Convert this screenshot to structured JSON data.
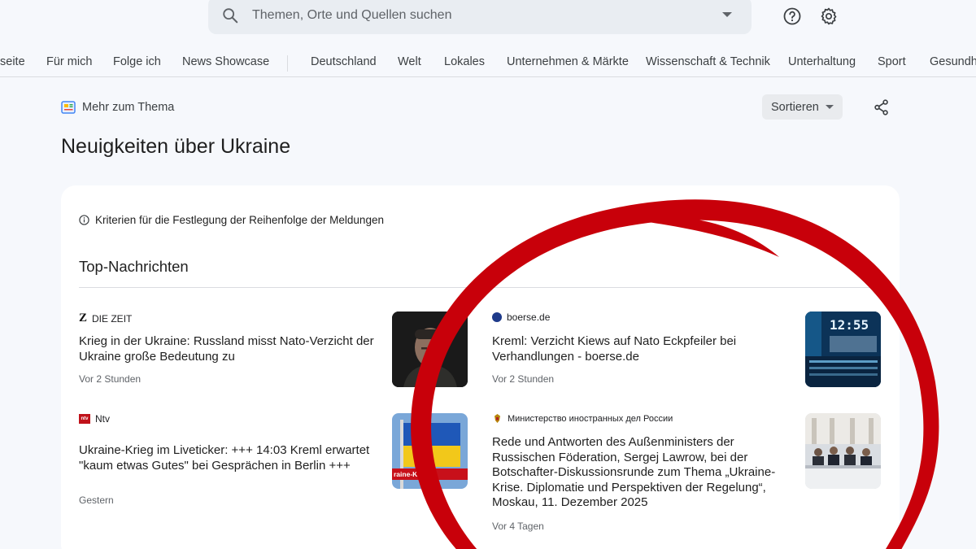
{
  "search": {
    "placeholder": "Themen, Orte und Quellen suchen"
  },
  "nav": {
    "items": [
      "seite",
      "Für mich",
      "Folge ich",
      "News Showcase",
      "Deutschland",
      "Welt",
      "Lokales",
      "Unternehmen & Märkte",
      "Wissenschaft & Technik",
      "Unterhaltung",
      "Sport",
      "Gesundhe"
    ]
  },
  "section": {
    "label": "Mehr zum Thema",
    "sort_label": "Sortieren",
    "title": "Neuigkeiten über Ukraine"
  },
  "card": {
    "criteria": "Kriterien für die Festlegung der Reihenfolge der Meldungen",
    "top_title": "Top-Nachrichten",
    "articles": [
      {
        "source": "DIE ZEIT",
        "logo": "Z",
        "headline": "Krieg in der Ukraine: Russland misst Nato-Verzicht der Ukraine große Bedeutung zu",
        "time": "Vor 2 Stunden"
      },
      {
        "source": "boerse.de",
        "headline": "Kreml: Verzicht Kiews auf Nato Eckpfeiler bei Verhandlungen - boerse.de",
        "time": "Vor 2 Stunden"
      },
      {
        "source": "Ntv",
        "logo": "ntv",
        "headline": "Ukraine-Krieg im Liveticker: +++ 14:03 Kreml erwartet \"kaum etwas Gutes\" bei Gesprächen in Berlin +++",
        "time": "Gestern"
      },
      {
        "source": "Министерство иностранных дел России",
        "headline": "Rede und Antworten des Außenministers der Russischen Föderation, Sergej Lawrow, bei der Botschafter-Diskussionsrunde zum Thema „Ukraine-Krise. Diplomatie und Perspektiven der Regelung“, Moskau, 11. Dezember 2025",
        "time": "Vor 4 Tagen"
      }
    ],
    "thumb_text": {
      "banner": "raine-Kr      etic",
      "clock": "12:55"
    }
  },
  "colors": {
    "accent_red": "#c8000a",
    "background": "#f6f8fc",
    "card": "#ffffff"
  }
}
